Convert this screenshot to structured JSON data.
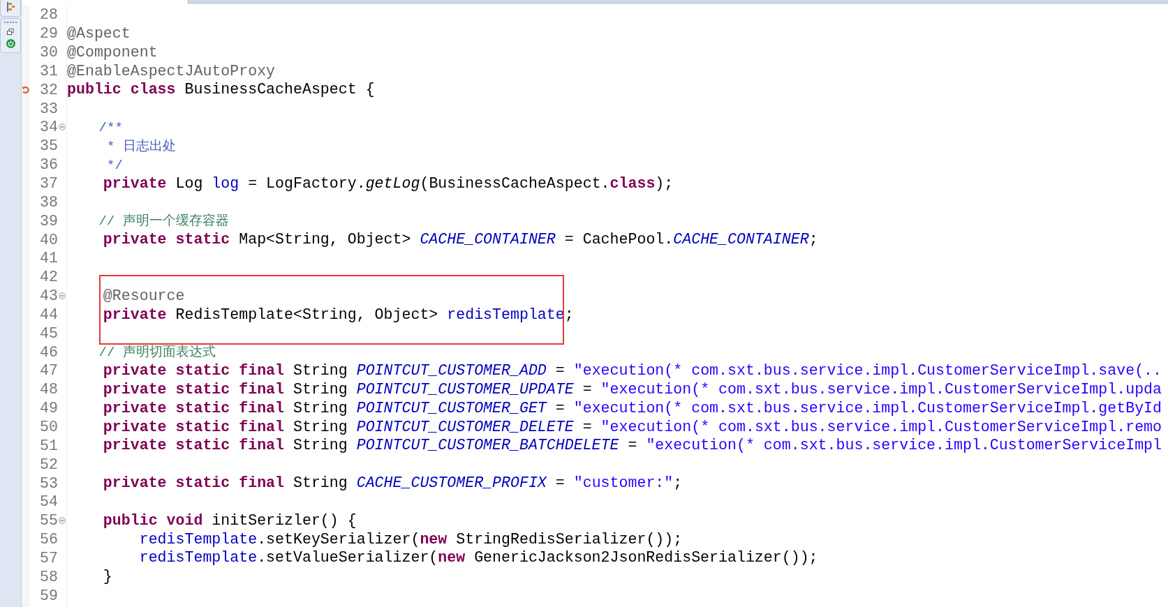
{
  "editor": {
    "lines": [
      {
        "number": "28",
        "kind": "plain"
      },
      {
        "number": "29",
        "kind": "plain",
        "tokens": [
          {
            "kind": "annotation",
            "text": "@Aspect"
          }
        ]
      },
      {
        "number": "30",
        "kind": "plain",
        "tokens": [
          {
            "kind": "annotation",
            "text": "@Component"
          }
        ]
      },
      {
        "number": "31",
        "kind": "plain",
        "tokens": [
          {
            "kind": "annotation",
            "text": "@EnableAspectJAutoProxy"
          }
        ]
      },
      {
        "number": "32",
        "kind": "override",
        "tokens": [
          {
            "kind": "keyword",
            "text": "public "
          },
          {
            "kind": "keyword",
            "text": "class"
          },
          {
            "kind": "plain",
            "text": " BusinessCacheAspect {"
          }
        ]
      },
      {
        "number": "33",
        "kind": "plain"
      },
      {
        "number": "34",
        "kind": "fold",
        "tokens": [
          {
            "kind": "javadoc",
            "text": "    /**"
          }
        ]
      },
      {
        "number": "35",
        "kind": "plain",
        "tokens": [
          {
            "kind": "javadoc",
            "text": "     * 日志出处"
          }
        ]
      },
      {
        "number": "36",
        "kind": "plain",
        "tokens": [
          {
            "kind": "javadoc",
            "text": "     */"
          }
        ]
      },
      {
        "number": "37",
        "kind": "plain",
        "tokens": [
          {
            "kind": "keyword",
            "text": "    private"
          },
          {
            "kind": "plain",
            "text": " Log "
          },
          {
            "kind": "field",
            "text": "log"
          },
          {
            "kind": "plain",
            "text": " = LogFactory."
          },
          {
            "kind": "static_method",
            "text": "getLog"
          },
          {
            "kind": "plain",
            "text": "(BusinessCacheAspect."
          },
          {
            "kind": "keyword",
            "text": "class"
          },
          {
            "kind": "plain",
            "text": ");"
          }
        ]
      },
      {
        "number": "38",
        "kind": "plain"
      },
      {
        "number": "39",
        "kind": "plain",
        "tokens": [
          {
            "kind": "comment",
            "text": "    // 声明一个缓存容器"
          }
        ]
      },
      {
        "number": "40",
        "kind": "plain",
        "tokens": [
          {
            "kind": "keyword",
            "text": "    private static"
          },
          {
            "kind": "plain",
            "text": " Map<String, Object> "
          },
          {
            "kind": "static_field",
            "text": "CACHE_CONTAINER"
          },
          {
            "kind": "plain",
            "text": " = CachePool."
          },
          {
            "kind": "static_field",
            "text": "CACHE_CONTAINER"
          },
          {
            "kind": "plain",
            "text": ";"
          }
        ]
      },
      {
        "number": "41",
        "kind": "plain"
      },
      {
        "number": "42",
        "kind": "plain"
      },
      {
        "number": "43",
        "kind": "fold",
        "tokens": [
          {
            "kind": "annotation",
            "text": "    @Resource"
          }
        ]
      },
      {
        "number": "44",
        "kind": "plain",
        "tokens": [
          {
            "kind": "keyword",
            "text": "    private"
          },
          {
            "kind": "plain",
            "text": " RedisTemplate<String, Object> "
          },
          {
            "kind": "field",
            "text": "redisTemplate"
          },
          {
            "kind": "plain",
            "text": ";"
          }
        ]
      },
      {
        "number": "45",
        "kind": "plain"
      },
      {
        "number": "46",
        "kind": "plain",
        "tokens": [
          {
            "kind": "comment",
            "text": "    // 声明切面表达式"
          }
        ]
      },
      {
        "number": "47",
        "kind": "plain",
        "tokens": [
          {
            "kind": "keyword",
            "text": "    private static final"
          },
          {
            "kind": "plain",
            "text": " String "
          },
          {
            "kind": "static_field",
            "text": "POINTCUT_CUSTOMER_ADD"
          },
          {
            "kind": "plain",
            "text": " = "
          },
          {
            "kind": "string",
            "text": "\"execution(* com.sxt.bus.service.impl.CustomerServiceImpl.save(.."
          }
        ]
      },
      {
        "number": "48",
        "kind": "plain",
        "tokens": [
          {
            "kind": "keyword",
            "text": "    private static final"
          },
          {
            "kind": "plain",
            "text": " String "
          },
          {
            "kind": "static_field",
            "text": "POINTCUT_CUSTOMER_UPDATE"
          },
          {
            "kind": "plain",
            "text": " = "
          },
          {
            "kind": "string",
            "text": "\"execution(* com.sxt.bus.service.impl.CustomerServiceImpl.upda"
          }
        ]
      },
      {
        "number": "49",
        "kind": "plain",
        "tokens": [
          {
            "kind": "keyword",
            "text": "    private static final"
          },
          {
            "kind": "plain",
            "text": " String "
          },
          {
            "kind": "static_field",
            "text": "POINTCUT_CUSTOMER_GET"
          },
          {
            "kind": "plain",
            "text": " = "
          },
          {
            "kind": "string",
            "text": "\"execution(* com.sxt.bus.service.impl.CustomerServiceImpl.getById"
          }
        ]
      },
      {
        "number": "50",
        "kind": "plain",
        "tokens": [
          {
            "kind": "keyword",
            "text": "    private static final"
          },
          {
            "kind": "plain",
            "text": " String "
          },
          {
            "kind": "static_field",
            "text": "POINTCUT_CUSTOMER_DELETE"
          },
          {
            "kind": "plain",
            "text": " = "
          },
          {
            "kind": "string",
            "text": "\"execution(* com.sxt.bus.service.impl.CustomerServiceImpl.remo"
          }
        ]
      },
      {
        "number": "51",
        "kind": "plain",
        "tokens": [
          {
            "kind": "keyword",
            "text": "    private static final"
          },
          {
            "kind": "plain",
            "text": " String "
          },
          {
            "kind": "static_field",
            "text": "POINTCUT_CUSTOMER_BATCHDELETE"
          },
          {
            "kind": "plain",
            "text": " = "
          },
          {
            "kind": "string",
            "text": "\"execution(* com.sxt.bus.service.impl.CustomerServiceImpl"
          }
        ]
      },
      {
        "number": "52",
        "kind": "plain"
      },
      {
        "number": "53",
        "kind": "plain",
        "tokens": [
          {
            "kind": "keyword",
            "text": "    private static final"
          },
          {
            "kind": "plain",
            "text": " String "
          },
          {
            "kind": "static_field",
            "text": "CACHE_CUSTOMER_PROFIX"
          },
          {
            "kind": "plain",
            "text": " = "
          },
          {
            "kind": "string",
            "text": "\"customer:\""
          },
          {
            "kind": "plain",
            "text": ";"
          }
        ]
      },
      {
        "number": "54",
        "kind": "plain"
      },
      {
        "number": "55",
        "kind": "fold",
        "tokens": [
          {
            "kind": "keyword",
            "text": "    public void"
          },
          {
            "kind": "plain",
            "text": " initSerizler() {"
          }
        ]
      },
      {
        "number": "56",
        "kind": "plain",
        "tokens": [
          {
            "kind": "field",
            "text": "        redisTemplate"
          },
          {
            "kind": "plain",
            "text": ".setKeySerializer("
          },
          {
            "kind": "keyword",
            "text": "new"
          },
          {
            "kind": "plain",
            "text": " StringRedisSerializer());"
          }
        ]
      },
      {
        "number": "57",
        "kind": "plain",
        "tokens": [
          {
            "kind": "field",
            "text": "        redisTemplate"
          },
          {
            "kind": "plain",
            "text": ".setValueSerializer("
          },
          {
            "kind": "keyword",
            "text": "new"
          },
          {
            "kind": "plain",
            "text": " GenericJackson2JsonRedisSerializer());"
          }
        ]
      },
      {
        "number": "58",
        "kind": "plain",
        "tokens": [
          {
            "kind": "plain",
            "text": "    }"
          }
        ]
      },
      {
        "number": "59",
        "kind": "plain"
      }
    ]
  }
}
